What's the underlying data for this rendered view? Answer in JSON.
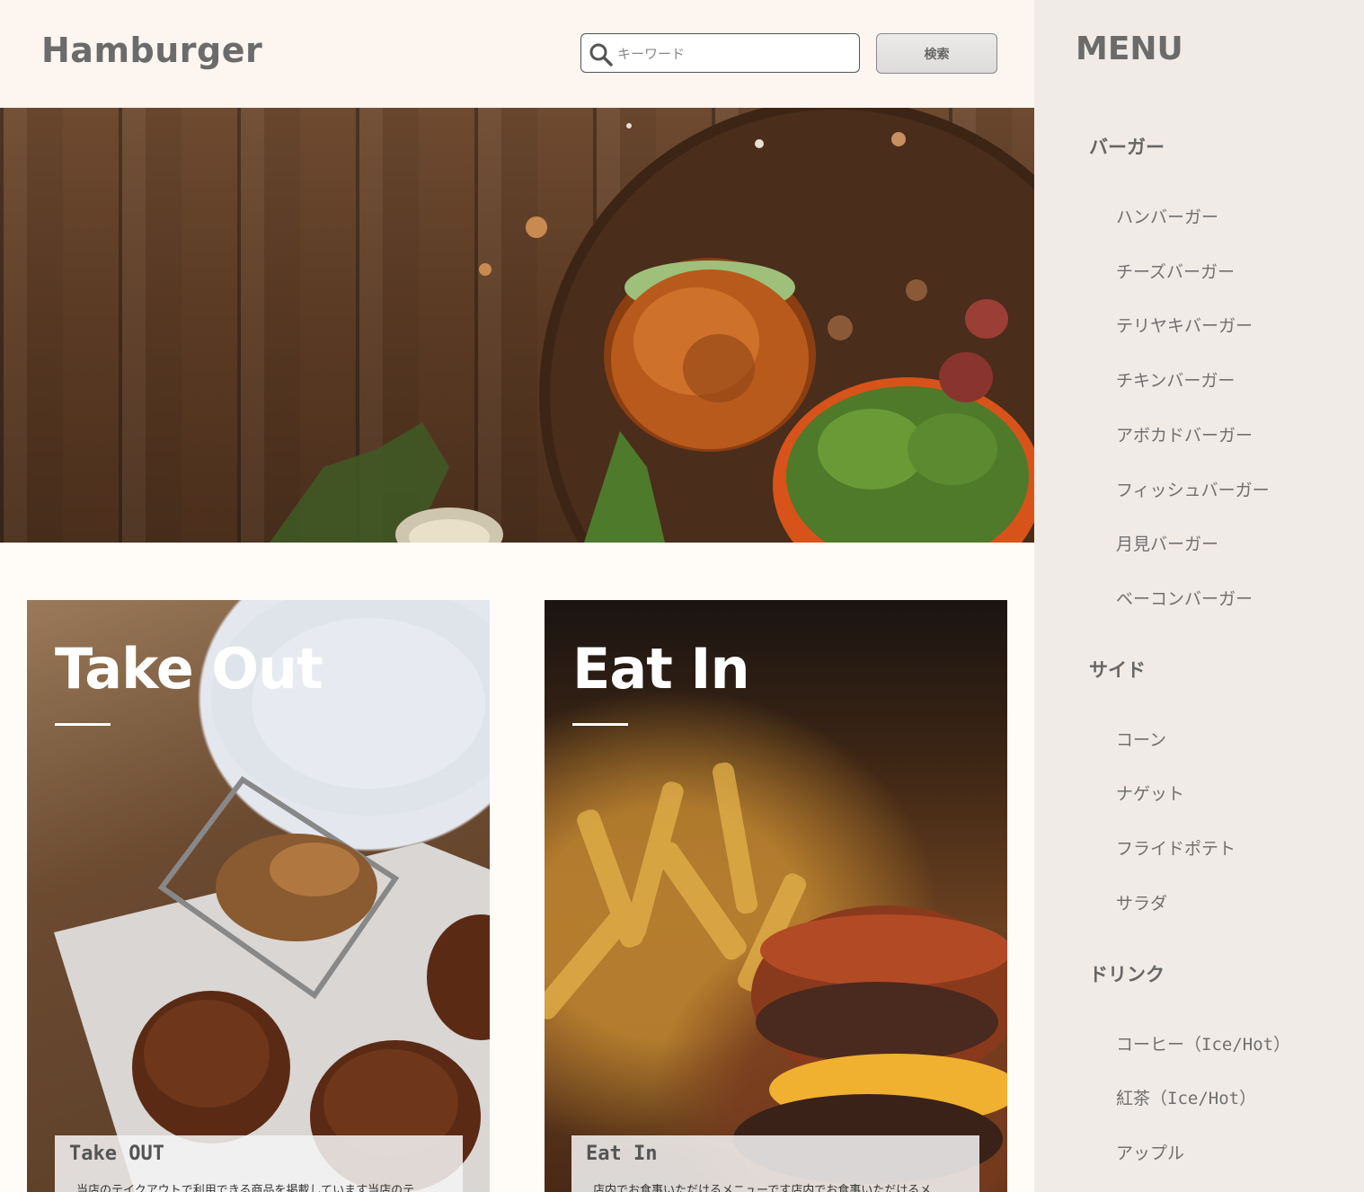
{
  "header": {
    "logo": "Hamburger",
    "search_placeholder": "キーワード",
    "search_button": "検索"
  },
  "cards": {
    "takeout": {
      "title": "Take Out",
      "panel_heading": "Take OUT",
      "panel_text": "当店のテイクアウトで利用できる商品を掲載しています当店のテ"
    },
    "eatin": {
      "title": "Eat In",
      "panel_heading": "Eat In",
      "panel_text": "店内でお食事いただけるメニューです店内でお食事いただけるメ"
    }
  },
  "sidebar": {
    "title": "MENU",
    "categories": [
      {
        "label": "バーガー",
        "items": [
          "ハンバーガー",
          "チーズバーガー",
          "テリヤキバーガー",
          "チキンバーガー",
          "アボカドバーガー",
          "フィッシュバーガー",
          "月見バーガー",
          "ベーコンバーガー"
        ]
      },
      {
        "label": "サイド",
        "items": [
          "コーン",
          "ナゲット",
          "フライドポテト",
          "サラダ"
        ]
      },
      {
        "label": "ドリンク",
        "items": [
          "コーヒー（Ice/Hot）",
          "紅茶（Ice/Hot）",
          "アップル"
        ]
      }
    ]
  }
}
